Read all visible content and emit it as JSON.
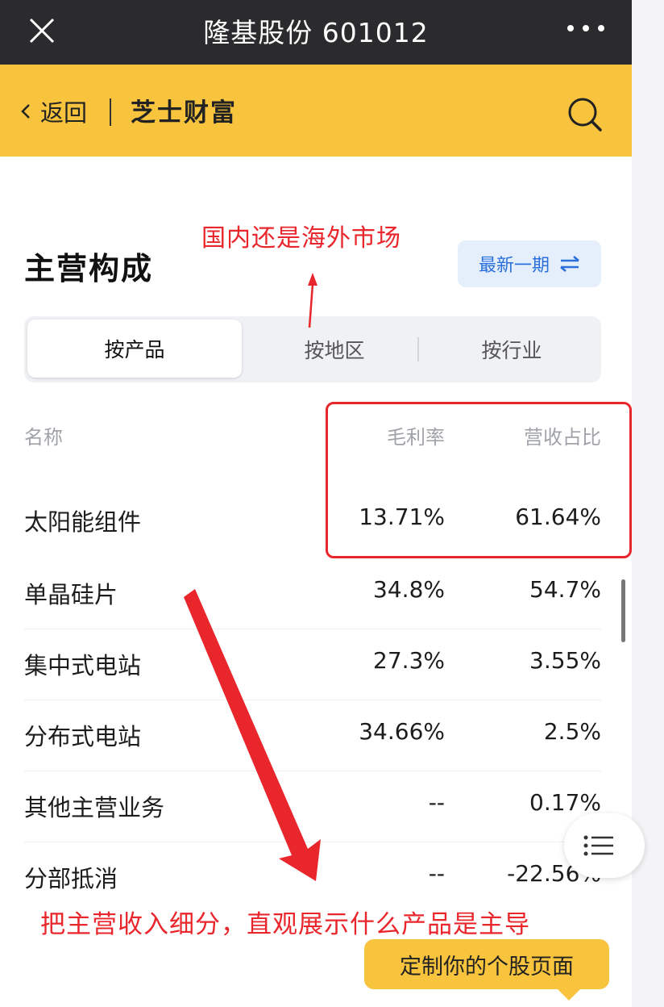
{
  "topbar": {
    "title": "隆基股份 601012"
  },
  "navbar": {
    "back_label": "返回",
    "brand": "芝士财富"
  },
  "section": {
    "title": "主营构成",
    "period_label": "最新一期"
  },
  "tabs": [
    {
      "label": "按产品"
    },
    {
      "label": "按地区"
    },
    {
      "label": "按行业"
    }
  ],
  "table": {
    "headers": {
      "name": "名称",
      "col1": "毛利率",
      "col2": "营收占比"
    },
    "rows": [
      {
        "name": "太阳能组件",
        "gross_margin": "13.71%",
        "revenue_share": "61.64%"
      },
      {
        "name": "单晶硅片",
        "gross_margin": "34.8%",
        "revenue_share": "54.7%"
      },
      {
        "name": "集中式电站",
        "gross_margin": "27.3%",
        "revenue_share": "3.55%"
      },
      {
        "name": "分布式电站",
        "gross_margin": "34.66%",
        "revenue_share": "2.5%"
      },
      {
        "name": "其他主营业务",
        "gross_margin": "--",
        "revenue_share": "0.17%"
      },
      {
        "name": "分部抵消",
        "gross_margin": "--",
        "revenue_share": "-22.56%"
      }
    ]
  },
  "annotations": {
    "top": "国内还是海外市场",
    "bottom": "把主营收入细分，直观展示什么产品是主导",
    "color": "#e8262c"
  },
  "floating": {
    "custom_button": "定制你的个股页面"
  },
  "colors": {
    "accent_yellow": "#f8c43e",
    "dark_bar": "#2b2b2d",
    "link_blue": "#2a6fdb"
  },
  "icons": [
    "close-icon",
    "more-icon",
    "back-chevron-icon",
    "search-icon",
    "swap-icon",
    "list-icon"
  ]
}
